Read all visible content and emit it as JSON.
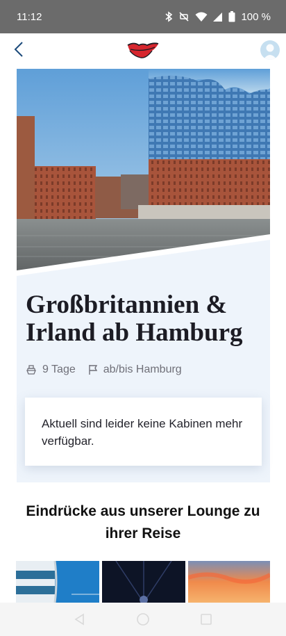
{
  "status_bar": {
    "time": "11:12",
    "battery": "100 %",
    "icons": [
      "bluetooth-icon",
      "mute-icon",
      "wifi-icon",
      "signal-icon",
      "battery-icon"
    ]
  },
  "app_bar": {
    "back_icon": "chevron-left-icon",
    "logo": "aida-lips-logo",
    "avatar": "user-avatar"
  },
  "trip": {
    "title": "Großbritannien & Irland ab Hamburg",
    "duration": "9 Tage",
    "duration_icon": "ship-icon",
    "route": "ab/bis Hamburg",
    "route_icon": "flag-icon",
    "notice": "Aktuell sind leider keine Kabinen mehr verfügbar."
  },
  "lounge": {
    "heading": "Eindrücke aus unserer Lounge zu ihrer Reise",
    "thumbnails": [
      "building-photo",
      "night-sky-photo",
      "sunset-photo"
    ]
  },
  "nav_bar": {
    "buttons": [
      "back-nav-icon",
      "home-nav-icon",
      "recents-nav-icon"
    ]
  },
  "colors": {
    "status_bar": "#6b6b6b",
    "card_bg": "#eef4fb",
    "accent_blue": "#1b4a7a",
    "logo_red": "#d6262e"
  }
}
